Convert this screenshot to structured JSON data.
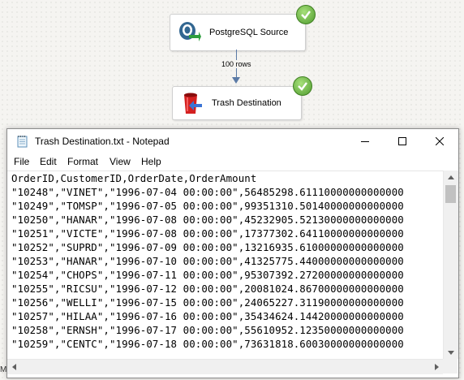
{
  "designer": {
    "source_label": "PostgreSQL Source",
    "destination_label": "Trash Destination",
    "path_label": "100 rows",
    "status_color": "#4f9b2e",
    "background_text": "Ma"
  },
  "notepad": {
    "title": "Trash Destination.txt - Notepad",
    "menu": [
      "File",
      "Edit",
      "Format",
      "View",
      "Help"
    ],
    "lines": [
      "OrderID,CustomerID,OrderDate,OrderAmount",
      "\"10248\",\"VINET\",\"1996-07-04 00:00:00\",56485298.61110000000000000",
      "\"10249\",\"TOMSP\",\"1996-07-05 00:00:00\",99351310.50140000000000000",
      "\"10250\",\"HANAR\",\"1996-07-08 00:00:00\",45232905.52130000000000000",
      "\"10251\",\"VICTE\",\"1996-07-08 00:00:00\",17377302.64110000000000000",
      "\"10252\",\"SUPRD\",\"1996-07-09 00:00:00\",13216935.61000000000000000",
      "\"10253\",\"HANAR\",\"1996-07-10 00:00:00\",41325775.44000000000000000",
      "\"10254\",\"CHOPS\",\"1996-07-11 00:00:00\",95307392.27200000000000000",
      "\"10255\",\"RICSU\",\"1996-07-12 00:00:00\",20081024.86700000000000000",
      "\"10256\",\"WELLI\",\"1996-07-15 00:00:00\",24065227.31190000000000000",
      "\"10257\",\"HILAA\",\"1996-07-16 00:00:00\",35434624.14420000000000000",
      "\"10258\",\"ERNSH\",\"1996-07-17 00:00:00\",55610952.12350000000000000",
      "\"10259\",\"CENTC\",\"1996-07-18 00:00:00\",73631818.60030000000000000"
    ]
  }
}
